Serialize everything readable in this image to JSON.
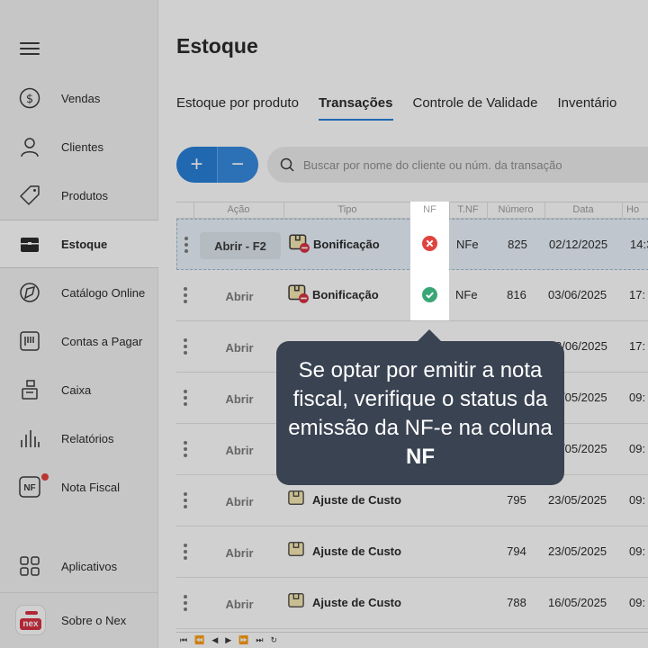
{
  "sidebar": {
    "items": [
      {
        "label": "Vendas",
        "icon": "dollar-circle-icon"
      },
      {
        "label": "Clientes",
        "icon": "user-icon"
      },
      {
        "label": "Produtos",
        "icon": "tag-icon"
      },
      {
        "label": "Estoque",
        "icon": "box-icon"
      },
      {
        "label": "Catálogo Online",
        "icon": "catalog-icon"
      },
      {
        "label": "Contas a Pagar",
        "icon": "invoice-icon"
      },
      {
        "label": "Caixa",
        "icon": "cash-register-icon"
      },
      {
        "label": "Relatórios",
        "icon": "bar-chart-icon"
      },
      {
        "label": "Nota Fiscal",
        "icon": "nf-icon"
      }
    ],
    "bottom": [
      {
        "label": "Aplicativos",
        "icon": "apps-grid-icon"
      },
      {
        "label": "Sobre o Nex",
        "icon": "nex-logo-icon"
      }
    ],
    "nex_logo_text": "nex"
  },
  "page": {
    "title": "Estoque",
    "tabs": [
      "Estoque por produto",
      "Transações",
      "Controle de Validade",
      "Inventário"
    ],
    "search_placeholder": "Buscar por nome do cliente ou núm. da transação",
    "add_symbol": "+",
    "remove_symbol": "−"
  },
  "table": {
    "headers": {
      "acao": "Ação",
      "tipo": "Tipo",
      "nf": "NF",
      "tnf": "T.NF",
      "numero": "Número",
      "data": "Data",
      "hora": "Ho"
    },
    "rows": [
      {
        "acao": "Abrir - F2",
        "tipo": "Bonificação",
        "nf_status": "error",
        "tnf": "NFe",
        "numero": "825",
        "data": "02/12/2025",
        "hora": "14:3"
      },
      {
        "acao": "Abrir",
        "tipo": "Bonificação",
        "nf_status": "success",
        "tnf": "NFe",
        "numero": "816",
        "data": "03/06/2025",
        "hora": "17:"
      },
      {
        "acao": "Abrir",
        "tipo": "",
        "nf_status": "",
        "tnf": "",
        "numero": "",
        "data": "3/06/2025",
        "hora": "17:"
      },
      {
        "acao": "Abrir",
        "tipo": "",
        "nf_status": "",
        "tnf": "",
        "numero": "",
        "data": "/05/2025",
        "hora": "09:"
      },
      {
        "acao": "Abrir",
        "tipo": "",
        "nf_status": "",
        "tnf": "",
        "numero": "",
        "data": "/05/2025",
        "hora": "09:"
      },
      {
        "acao": "Abrir",
        "tipo": "Ajuste de Custo",
        "nf_status": "",
        "tnf": "",
        "numero": "795",
        "data": "23/05/2025",
        "hora": "09:"
      },
      {
        "acao": "Abrir",
        "tipo": "Ajuste de Custo",
        "nf_status": "",
        "tnf": "",
        "numero": "794",
        "data": "23/05/2025",
        "hora": "09:"
      },
      {
        "acao": "Abrir",
        "tipo": "Ajuste de Custo",
        "nf_status": "",
        "tnf": "",
        "numero": "788",
        "data": "16/05/2025",
        "hora": "09:"
      }
    ],
    "pager": [
      "⏮",
      "⏪",
      "◀",
      "▶",
      "⏩",
      "⏭",
      "↻"
    ]
  },
  "tooltip": {
    "text": "Se optar por emitir a nota fiscal, verifique o status da emissão da NF-e na coluna",
    "bold": "NF"
  },
  "colors": {
    "accent": "#1e7ad6",
    "error": "#e0433f",
    "success": "#3aa676",
    "tooltip_bg": "#3a4352"
  }
}
